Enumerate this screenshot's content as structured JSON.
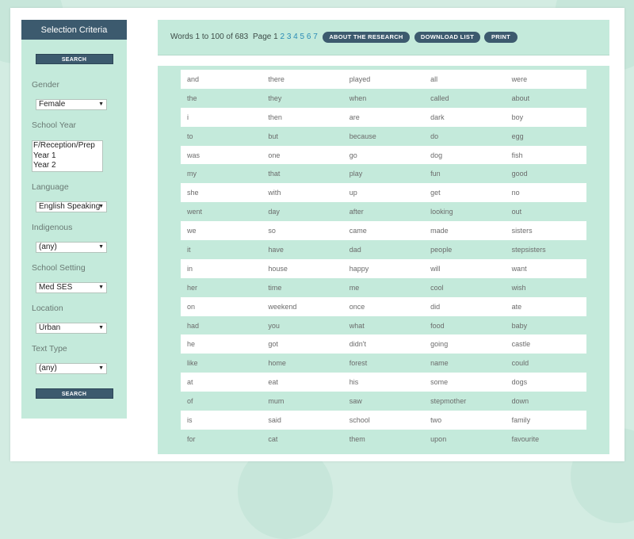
{
  "sidebar": {
    "title": "Selection Criteria",
    "search_label": "SEARCH",
    "gender": {
      "label": "Gender",
      "value": "Female"
    },
    "school_year": {
      "label": "School Year",
      "options": [
        "F/Reception/Prep",
        "Year 1",
        "Year 2"
      ]
    },
    "language": {
      "label": "Language",
      "value": "English Speaking"
    },
    "indigenous": {
      "label": "Indigenous",
      "value": "(any)"
    },
    "school_setting": {
      "label": "School Setting",
      "value": "Med SES"
    },
    "location": {
      "label": "Location",
      "value": "Urban"
    },
    "text_type": {
      "label": "Text Type",
      "value": "(any)"
    }
  },
  "toolbar": {
    "info": "Words 1 to 100 of 683",
    "page_label": "Page",
    "current_page": "1",
    "pages": [
      "2",
      "3",
      "4",
      "5",
      "6",
      "7"
    ],
    "about": "ABOUT THE RESEARCH",
    "download": "DOWNLOAD LIST",
    "print": "PRINT"
  },
  "words": [
    [
      "and",
      "there",
      "played",
      "all",
      "were"
    ],
    [
      "the",
      "they",
      "when",
      "called",
      "about"
    ],
    [
      "i",
      "then",
      "are",
      "dark",
      "boy"
    ],
    [
      "to",
      "but",
      "because",
      "do",
      "egg"
    ],
    [
      "was",
      "one",
      "go",
      "dog",
      "fish"
    ],
    [
      "my",
      "that",
      "play",
      "fun",
      "good"
    ],
    [
      "she",
      "with",
      "up",
      "get",
      "no"
    ],
    [
      "went",
      "day",
      "after",
      "looking",
      "out"
    ],
    [
      "we",
      "so",
      "came",
      "made",
      "sisters"
    ],
    [
      "it",
      "have",
      "dad",
      "people",
      "stepsisters"
    ],
    [
      "in",
      "house",
      "happy",
      "will",
      "want"
    ],
    [
      "her",
      "time",
      "me",
      "cool",
      "wish"
    ],
    [
      "on",
      "weekend",
      "once",
      "did",
      "ate"
    ],
    [
      "had",
      "you",
      "what",
      "food",
      "baby"
    ],
    [
      "he",
      "got",
      "didn't",
      "going",
      "castle"
    ],
    [
      "like",
      "home",
      "forest",
      "name",
      "could"
    ],
    [
      "at",
      "eat",
      "his",
      "some",
      "dogs"
    ],
    [
      "of",
      "mum",
      "saw",
      "stepmother",
      "down"
    ],
    [
      "is",
      "said",
      "school",
      "two",
      "family"
    ],
    [
      "for",
      "cat",
      "them",
      "upon",
      "favourite"
    ]
  ]
}
